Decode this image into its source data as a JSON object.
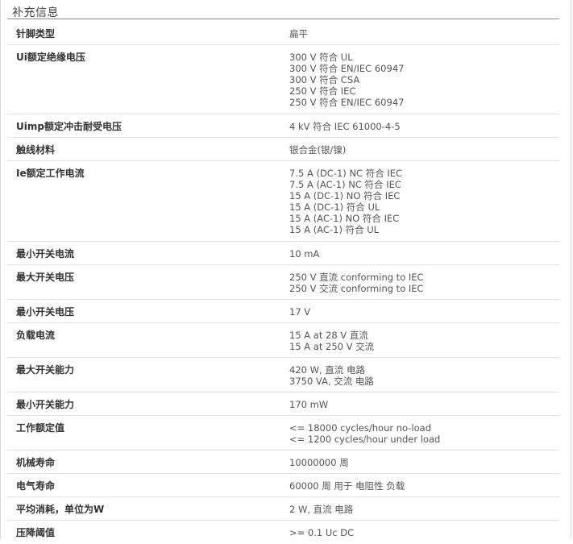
{
  "section": {
    "title": "补充信息"
  },
  "specs": [
    {
      "label": "针脚类型",
      "values": [
        "扁平"
      ]
    },
    {
      "label": "Ui额定绝缘电压",
      "values": [
        "300 V 符合 UL",
        "300 V 符合 EN/IEC 60947",
        "300 V 符合 CSA",
        "250 V 符合 IEC",
        "250 V 符合 EN/IEC 60947"
      ]
    },
    {
      "label": "Uimp额定冲击耐受电压",
      "values": [
        "4 kV 符合 IEC 61000-4-5"
      ]
    },
    {
      "label": "触线材料",
      "values": [
        "银合金(银/镍)"
      ]
    },
    {
      "label": "Ie额定工作电流",
      "values": [
        "7.5 A (DC-1) NC 符合 IEC",
        "7.5 A (AC-1) NC 符合 IEC",
        "15 A (DC-1) NO 符合 IEC",
        "15 A (DC-1) 符合 UL",
        "15 A (AC-1) NO 符合 IEC",
        "15 A (AC-1) 符合 UL"
      ]
    },
    {
      "label": "最小开关电流",
      "values": [
        "10 mA"
      ]
    },
    {
      "label": "最大开关电压",
      "values": [
        "250 V 直流 conforming to IEC",
        "250 V 交流 conforming to IEC"
      ]
    },
    {
      "label": "最小开关电压",
      "values": [
        "17 V"
      ]
    },
    {
      "label": "负载电流",
      "values": [
        "15 A at 28 V 直流",
        "15 A at 250 V 交流"
      ]
    },
    {
      "label": "最大开关能力",
      "values": [
        "420 W, 直流 电路",
        "3750 VA, 交流 电路"
      ]
    },
    {
      "label": "最小开关能力",
      "values": [
        "170 mW"
      ]
    },
    {
      "label": "工作额定值",
      "values": [
        "<= 18000 cycles/hour no-load",
        "<= 1200 cycles/hour under load"
      ]
    },
    {
      "label": "机械寿命",
      "values": [
        "10000000 周"
      ]
    },
    {
      "label": "电气寿命",
      "values": [
        "60000 周 用于 电阻性 负载"
      ]
    },
    {
      "label": "平均消耗，单位为W",
      "values": [
        "2 W, 直流 电路"
      ]
    },
    {
      "label": "压降阈值",
      "values": [
        ">= 0.1 Uc DC"
      ]
    }
  ]
}
